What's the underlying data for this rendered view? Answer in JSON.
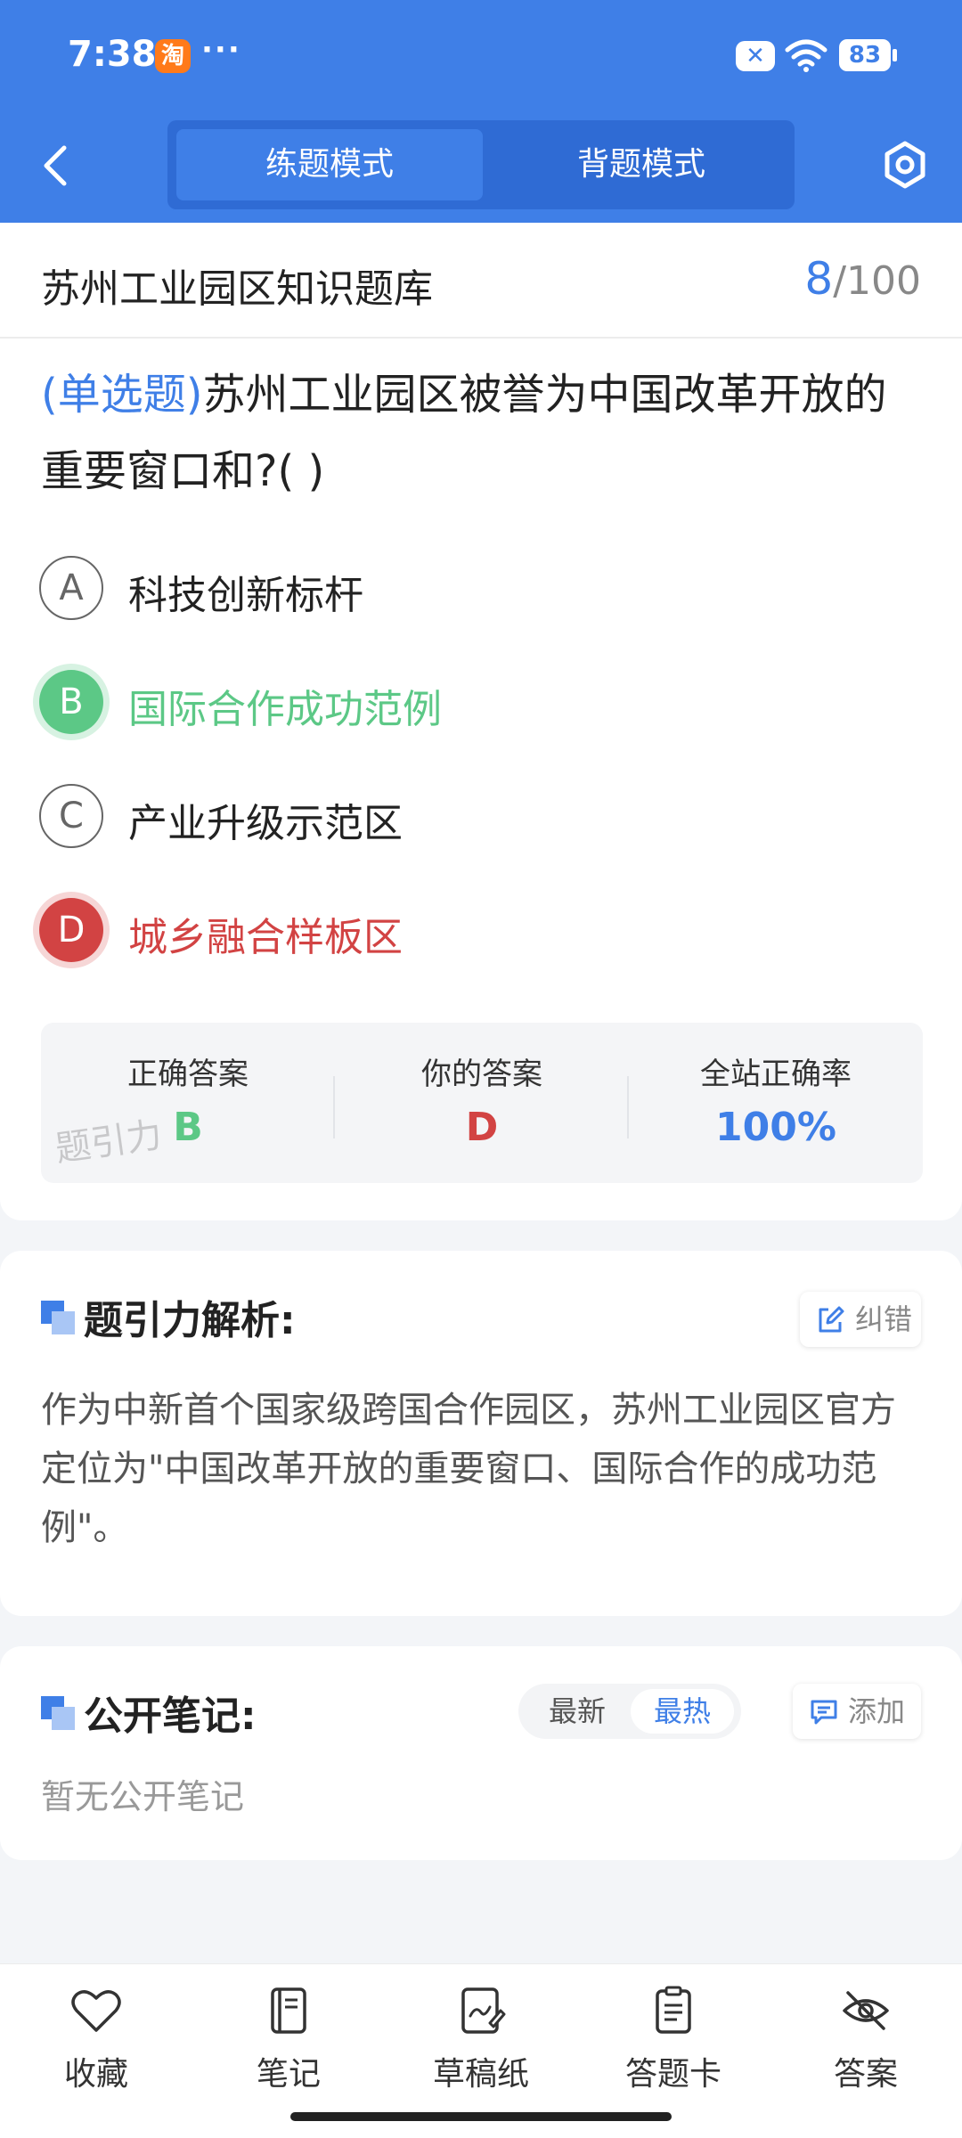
{
  "status_bar": {
    "time": "7:38",
    "app_icon_text": "淘",
    "more": "···",
    "battery": "83"
  },
  "header": {
    "tabs": [
      {
        "label": "练题模式",
        "active": true
      },
      {
        "label": "背题模式",
        "active": false
      }
    ]
  },
  "question_bank": {
    "title": "苏州工业园区知识题库",
    "current": "8",
    "total": "/100"
  },
  "question": {
    "type": "(单选题)",
    "text": "苏州工业园区被誉为中国改革开放的重要窗口和?(     )",
    "options": [
      {
        "letter": "A",
        "text": "科技创新标杆",
        "state": "normal"
      },
      {
        "letter": "B",
        "text": "国际合作成功范例",
        "state": "correct"
      },
      {
        "letter": "C",
        "text": "产业升级示范区",
        "state": "normal"
      },
      {
        "letter": "D",
        "text": "城乡融合样板区",
        "state": "wrong"
      }
    ]
  },
  "stats": {
    "correct_label": "正确答案",
    "correct_value": "B",
    "yours_label": "你的答案",
    "yours_value": "D",
    "rate_label": "全站正确率",
    "rate_value": "100%",
    "watermark": "题引力"
  },
  "analysis": {
    "title": "题引力解析:",
    "report_label": "纠错",
    "text": "作为中新首个国家级跨国合作园区，苏州工业园区官方定位为\"中国改革开放的重要窗口、国际合作的成功范例\"。"
  },
  "notes": {
    "title": "公开笔记:",
    "sort_latest": "最新",
    "sort_hot": "最热",
    "add_label": "添加",
    "empty_text": "暂无公开笔记"
  },
  "bottom_nav": {
    "items": [
      {
        "label": "收藏",
        "icon": "heart-icon"
      },
      {
        "label": "笔记",
        "icon": "notebook-icon"
      },
      {
        "label": "草稿纸",
        "icon": "draft-icon"
      },
      {
        "label": "答题卡",
        "icon": "answer-sheet-icon"
      },
      {
        "label": "答案",
        "icon": "eye-off-icon"
      }
    ]
  },
  "colors": {
    "brand": "#3f7fe7",
    "correct": "#5cc886",
    "wrong": "#d24343"
  }
}
